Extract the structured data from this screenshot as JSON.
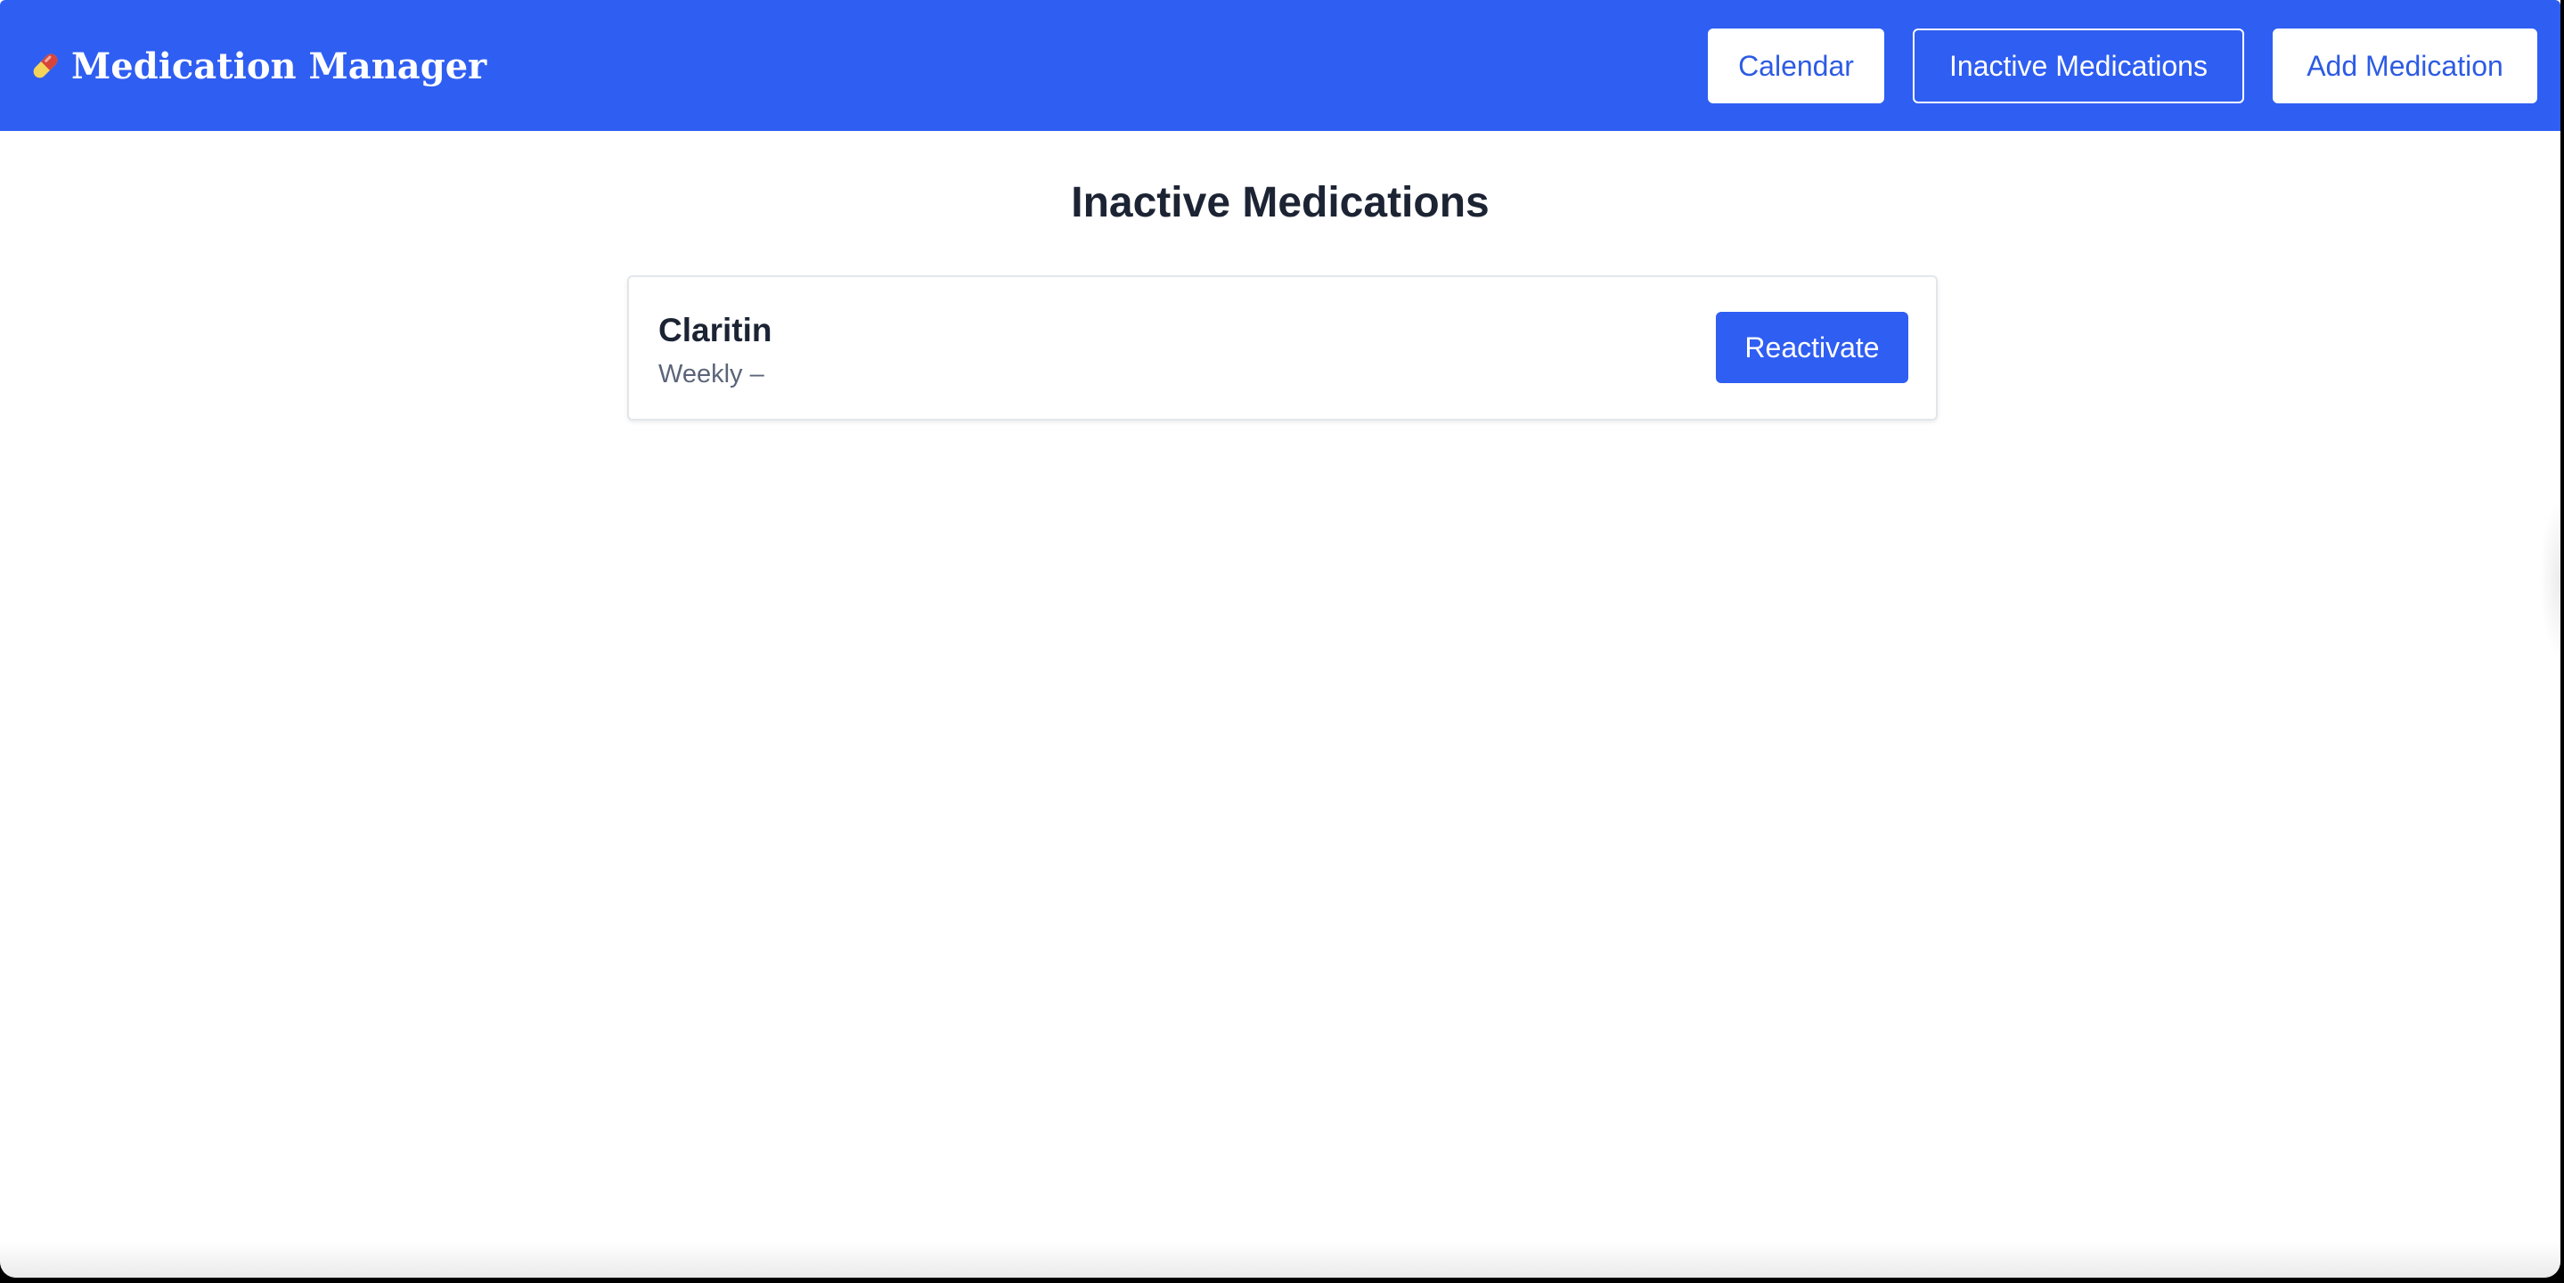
{
  "header": {
    "app_icon": "pill-icon",
    "app_title": "Medication Manager",
    "nav": {
      "calendar_label": "Calendar",
      "inactive_label": "Inactive Medications",
      "add_label": "Add Medication"
    }
  },
  "main": {
    "title": "Inactive Medications",
    "medications": [
      {
        "name": "Claritin",
        "schedule": "Weekly –",
        "action_label": "Reactivate"
      }
    ]
  },
  "colors": {
    "brand_blue": "#2f5ef2",
    "text_dark": "#1c2434",
    "text_muted": "#5b6578"
  }
}
